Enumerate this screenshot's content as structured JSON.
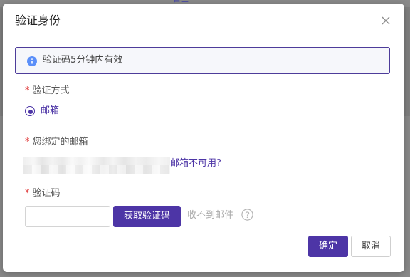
{
  "backdrop": {
    "link_fragment": "首兰"
  },
  "dialog": {
    "title": "验证身份",
    "close_icon": "close-icon",
    "info": {
      "icon": "info-icon",
      "text": "验证码5分钟内有效",
      "accent_color": "#4d35a6"
    },
    "method": {
      "required_mark": "*",
      "label": "验证方式",
      "options": [
        {
          "label": "邮箱",
          "selected": true
        }
      ]
    },
    "email": {
      "required_mark": "*",
      "label": "您绑定的邮箱",
      "value_masked": true,
      "unavailable_link": "邮箱不可用?"
    },
    "code": {
      "required_mark": "*",
      "label": "验证码",
      "input_value": "",
      "get_code_button": "获取验证码",
      "not_received_text": "收不到邮件",
      "help_icon": "question-circle-icon"
    },
    "footer": {
      "confirm_button": "确定",
      "cancel_button": "取消"
    }
  }
}
